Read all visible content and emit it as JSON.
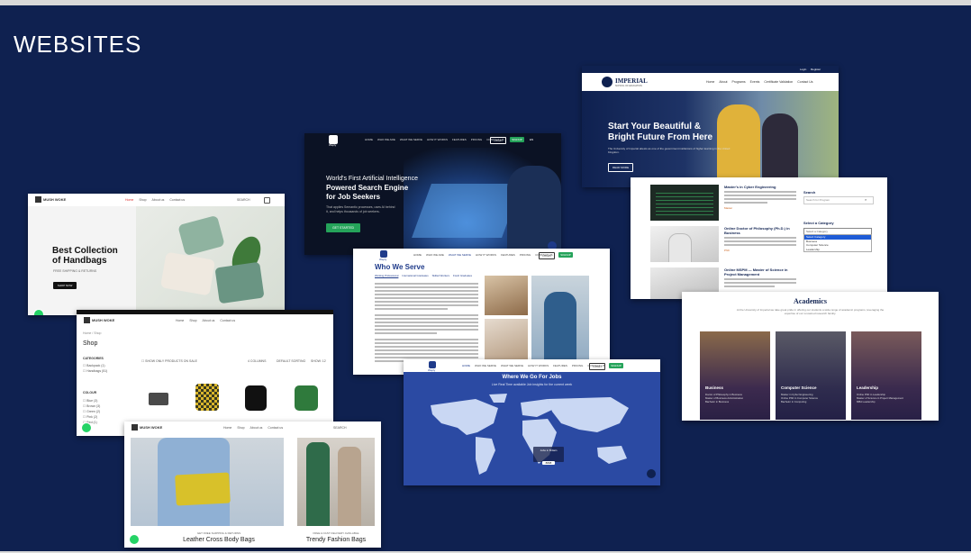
{
  "slide": {
    "title": "WEBSITES",
    "background": "#0f2150"
  },
  "handbag_home": {
    "brand": "MUSH WOKE",
    "nav": [
      "Home",
      "Shop",
      "About us",
      "Contact us"
    ],
    "search": "SEARCH",
    "hero_title_1": "Best Collection",
    "hero_title_2": "of Handbags",
    "hero_sub": "FREE SHIPPING & RETURNS",
    "cta": "SHOP NOW"
  },
  "handbag_shop": {
    "brand": "MUSH WOKE",
    "nav": [
      "Home",
      "Shop",
      "About us",
      "Contact us"
    ],
    "breadcrumb": "Home / Shop",
    "title": "Shop",
    "categories_label": "CATEGORIES",
    "categories": [
      "Backpack (1)",
      "Handbags (51)"
    ],
    "colour_label": "COLOUR",
    "colours": [
      "Blue (3)",
      "Brown (3)",
      "Green (2)",
      "Pink (2)",
      "Red (1)"
    ],
    "filter": "SHOW ONLY PRODUCTS ON SALE",
    "sort": "DEFAULT SORTING",
    "show": "SHOW: 12",
    "columns": "4 COLUMNS"
  },
  "handbag_collection": {
    "brand": "MUSH WOKE",
    "nav": [
      "Home",
      "Shop",
      "About us",
      "Contact us"
    ],
    "search": "SEARCH",
    "left_caption": "GET FREE SHIPPING & RETURNS",
    "left_title": "Leather Cross Body Bags",
    "right_caption": "FREE & FAST DELIVERY AVAILABLE",
    "right_title": "Trendy Fashion Bags"
  },
  "weply_hero": {
    "brand": "Weply",
    "nav": [
      "HOME",
      "WHO WE ARE",
      "WHAT WE SERVE",
      "HOW IT WORKS",
      "FEATURES",
      "PRICING",
      "CONTACT US"
    ],
    "login": "LOGIN",
    "signup": "SIGNUP",
    "lang": "EN",
    "headline_1": "World's First Artificial Intelligence",
    "headline_2": "Powered Search Engine",
    "headline_3": "for Job Seekers",
    "body": "That applies Semantic processes, uses AI behind it, and helps thousands of job seekers.",
    "cta": "GET STARTED"
  },
  "weply_serve": {
    "brand": "Weply",
    "nav": [
      "HOME",
      "WHO WE ARE",
      "WHAT WE SERVE",
      "HOW IT WORKS",
      "FEATURES",
      "PRICING",
      "CONTACT US"
    ],
    "login": "LOGIN",
    "signup": "SIGNUP",
    "title": "Who We Serve",
    "tabs": [
      "Working Professional",
      "International Graduates",
      "Skilled Workers",
      "Fresh Graduates"
    ]
  },
  "weply_jobs": {
    "brand": "Weply",
    "nav": [
      "HOME",
      "WHO WE SERVE",
      "WHAT WE SERVE",
      "HOW IT WORKS",
      "FEATURES",
      "PRICING",
      "CONTACT US"
    ],
    "login": "LOGIN",
    "signup": "SIGNUP",
    "title": "Where We Go For Jobs",
    "subtitle": "Live Real Time available Job insights for the current week",
    "tooltip_label": "Jobs in Britain",
    "tooltip_value": "8808"
  },
  "imperial_home": {
    "brand": "IMPERIAL",
    "brand_sub": "SCHOOL OF EDUCATION",
    "top_links": [
      "Login",
      "Register"
    ],
    "nav": [
      "Home",
      "About",
      "Programs",
      "Events",
      "Certificate Validation",
      "Contact Us"
    ],
    "hero_1": "Start Your Beautiful &",
    "hero_2": "Bright Future From Here",
    "hero_body": "The University of Imperial attests as one of the government institutions of higher learning in the United Kingdom.",
    "cta": "READ MORE"
  },
  "imperial_programs": {
    "programs": [
      {
        "title": "Master's in Cyber Engineering",
        "tag": "Master"
      },
      {
        "title": "Online Doctor of Philosophy (Ph.D.) in Business",
        "tag": "PhD"
      },
      {
        "title": "Online MSPM — Master of Science in Project Management",
        "tag": "Master"
      }
    ],
    "search_label": "Search",
    "search_placeholder": "Search for Program",
    "category_label": "Select a Category",
    "category_placeholder": "Select a Category",
    "category_options": [
      "Select Category",
      "Business",
      "Computer Science",
      "Leadership"
    ]
  },
  "imperial_academics": {
    "title": "Academics",
    "body": "At the University of Imperial we take great pride in offering our students a wide range of academic programs, leveraging the expertise of our renowned research faculty.",
    "columns": [
      {
        "title": "Business",
        "items": [
          "Doctor of Philosophy in Business",
          "Master of Business Administration",
          "Bachelor in Business"
        ]
      },
      {
        "title": "Computer Science",
        "items": [
          "Master in Cyber Engineering",
          "Online PhD in Computer Science",
          "Bachelor in Computing"
        ]
      },
      {
        "title": "Leadership",
        "items": [
          "Online PhD in Leadership",
          "Master of Science in Project Management",
          "MBA Leadership"
        ]
      }
    ]
  }
}
